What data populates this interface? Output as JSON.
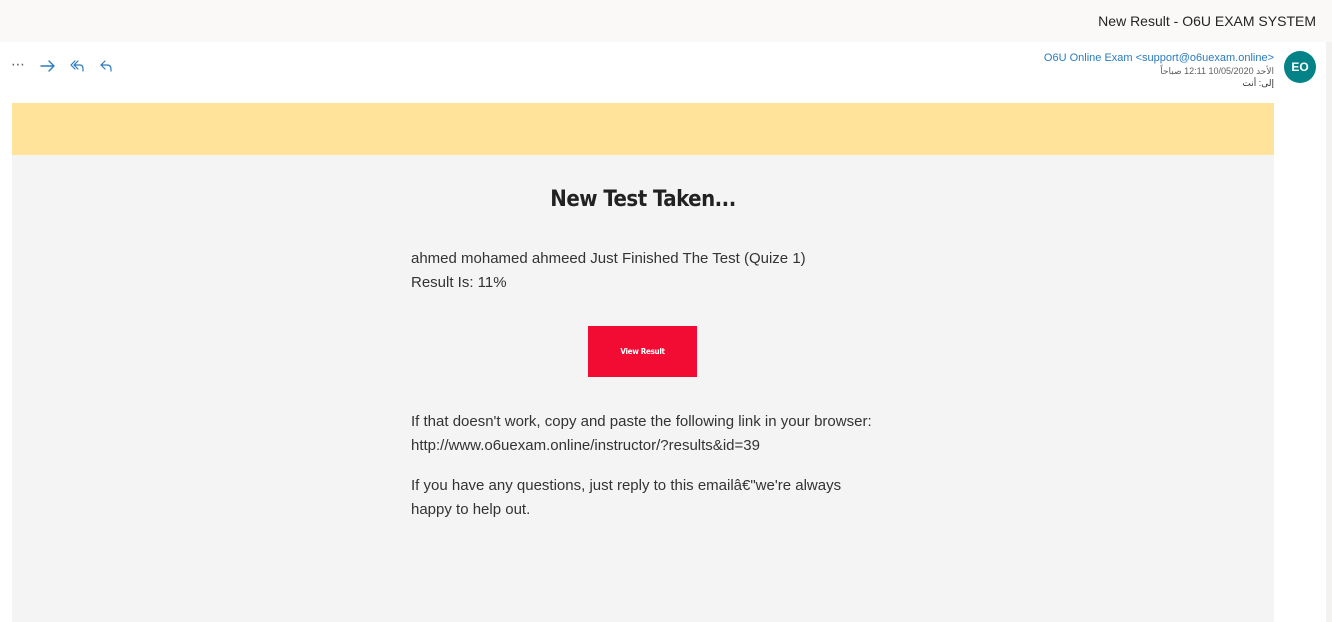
{
  "window": {
    "subject": "New Result - O6U EXAM SYSTEM"
  },
  "actions": {
    "more": "⋯",
    "icons": [
      "more-options-icon",
      "forward-icon",
      "reply-all-icon",
      "reply-icon"
    ]
  },
  "message": {
    "sender": "O6U Online Exam <support@o6uexam.online>",
    "date": "الأحد 10/05/2020 12:11 صباحاً",
    "to": "إلى: أنت",
    "avatar_initials": "EO"
  },
  "email": {
    "banner_color": "#ffe39a",
    "heading": "New Test Taken...",
    "line1": "ahmed mohamed ahmeed Just Finished The Test (Quize 1)",
    "line2": "Result Is: 11%",
    "button": "View Result",
    "button_color": "#f20c33",
    "fallback": "If that doesn't work, copy and paste the following link in your browser: http://www.o6uexam.online/instructor/?results&id=39",
    "closing": "If you have any questions, just reply to this emailâ€\"we're always happy to help out."
  },
  "colors": {
    "avatar": "#038387",
    "link": "#2b7bbd"
  }
}
